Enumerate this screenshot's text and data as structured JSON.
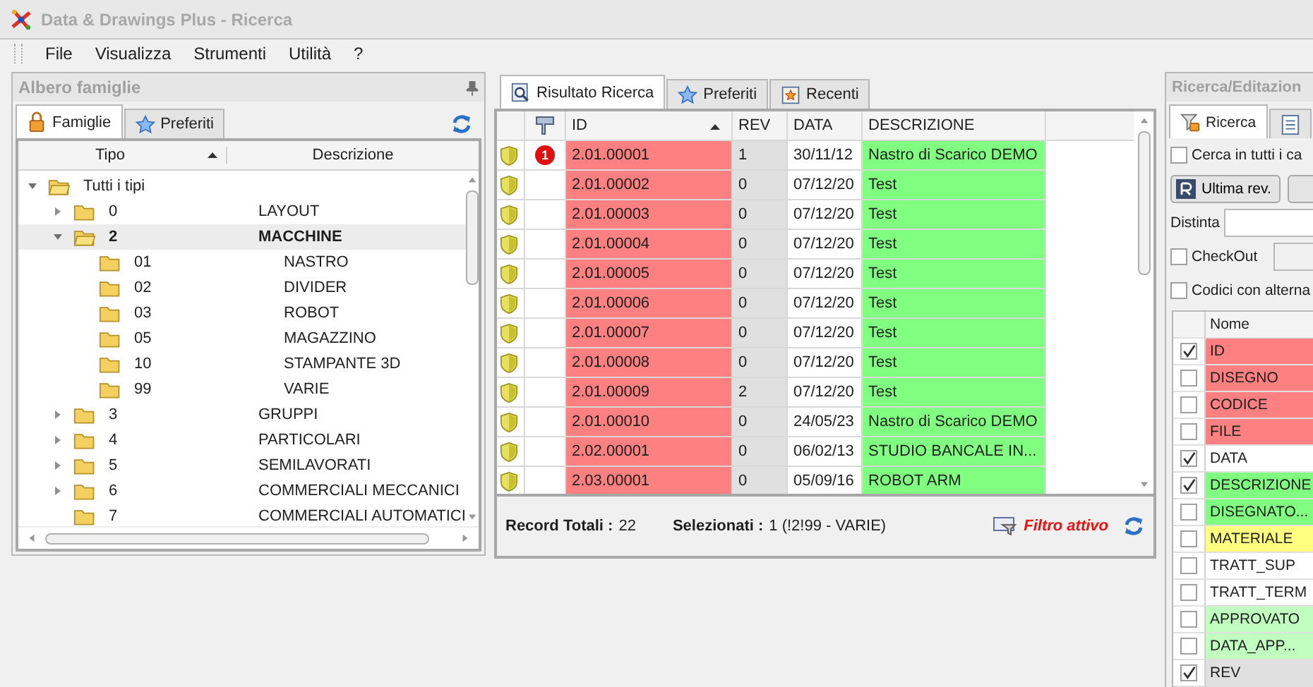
{
  "window": {
    "title": "Data & Drawings Plus - Ricerca"
  },
  "menu": [
    "File",
    "Visualizza",
    "Strumenti",
    "Utilità",
    "?"
  ],
  "left_panel": {
    "title": "Albero famiglie",
    "tabs": [
      {
        "label": "Famiglie",
        "selected": true
      },
      {
        "label": "Preferiti",
        "selected": false
      }
    ],
    "tree_columns": [
      "Tipo",
      "Descrizione"
    ],
    "tree": [
      {
        "code": "Tutti i tipi",
        "expanded": true,
        "selected": false,
        "children": [
          {
            "code": "0",
            "description": "LAYOUT",
            "expanded": false,
            "selected": false
          },
          {
            "code": "2",
            "description": "MACCHINE",
            "expanded": true,
            "selected": true,
            "children": [
              {
                "code": "01",
                "description": "NASTRO",
                "selected": false
              },
              {
                "code": "02",
                "description": "DIVIDER",
                "selected": false
              },
              {
                "code": "03",
                "description": "ROBOT",
                "selected": false
              },
              {
                "code": "05",
                "description": "MAGAZZINO",
                "selected": false
              },
              {
                "code": "10",
                "description": "STAMPANTE 3D",
                "selected": false
              },
              {
                "code": "99",
                "description": "VARIE",
                "selected": false
              }
            ]
          },
          {
            "code": "3",
            "description": "GRUPPI",
            "expanded": false,
            "selected": false
          },
          {
            "code": "4",
            "description": "PARTICOLARI",
            "expanded": false,
            "selected": false
          },
          {
            "code": "5",
            "description": "SEMILAVORATI",
            "expanded": false,
            "selected": false
          },
          {
            "code": "6",
            "description": "COMMERCIALI MECCANICI",
            "expanded": false,
            "selected": false
          },
          {
            "code": "7",
            "description": "COMMERCIALI AUTOMATICI",
            "selected": false
          }
        ]
      }
    ]
  },
  "center_panel": {
    "tabs": [
      {
        "label": "Risultato Ricerca",
        "selected": true
      },
      {
        "label": "Preferiti",
        "selected": false
      },
      {
        "label": "Recenti",
        "selected": false
      }
    ],
    "columns": [
      "ID",
      "REV",
      "DATA",
      "DESCRIZIONE"
    ],
    "rows": [
      {
        "badge": "1",
        "id": "2.01.00001",
        "rev": "1",
        "date": "30/11/12",
        "description": "Nastro di Scarico DEMO"
      },
      {
        "id": "2.01.00002",
        "rev": "0",
        "date": "07/12/20",
        "description": "Test"
      },
      {
        "id": "2.01.00003",
        "rev": "0",
        "date": "07/12/20",
        "description": "Test"
      },
      {
        "id": "2.01.00004",
        "rev": "0",
        "date": "07/12/20",
        "description": "Test"
      },
      {
        "id": "2.01.00005",
        "rev": "0",
        "date": "07/12/20",
        "description": "Test"
      },
      {
        "id": "2.01.00006",
        "rev": "0",
        "date": "07/12/20",
        "description": "Test"
      },
      {
        "id": "2.01.00007",
        "rev": "0",
        "date": "07/12/20",
        "description": "Test"
      },
      {
        "id": "2.01.00008",
        "rev": "0",
        "date": "07/12/20",
        "description": "Test"
      },
      {
        "id": "2.01.00009",
        "rev": "2",
        "date": "07/12/20",
        "description": "Test"
      },
      {
        "id": "2.01.00010",
        "rev": "0",
        "date": "24/05/23",
        "description": "Nastro di Scarico DEMO"
      },
      {
        "id": "2.02.00001",
        "rev": "0",
        "date": "06/02/13",
        "description": "STUDIO BANCALE IN..."
      },
      {
        "id": "2.03.00001",
        "rev": "0",
        "date": "05/09/16",
        "description": "ROBOT ARM"
      }
    ],
    "status": {
      "total_label": "Record Totali :",
      "total": "22",
      "selected_label": "Selezionati :",
      "selected": "1 (!2!99 - VARIE)",
      "filter": "Filtro attivo"
    }
  },
  "right_panel": {
    "title": "Ricerca/Editazion",
    "tabs": [
      {
        "label": "Ricerca",
        "selected": true
      },
      {
        "selected": false
      }
    ],
    "search_all": {
      "label": "Cerca in tutti i ca",
      "checked": false
    },
    "button": "Ultima rev.",
    "distinta_label": "Distinta",
    "checkout": {
      "label": "CheckOut",
      "checked": false
    },
    "alternatives": {
      "label": "Codici con alterna",
      "checked": false
    },
    "list_header": "Nome",
    "fields": [
      {
        "name": "ID",
        "checked": true,
        "color": "#ff8080"
      },
      {
        "name": "DISEGNO",
        "checked": false,
        "color": "#ff8080"
      },
      {
        "name": "CODICE",
        "checked": false,
        "color": "#ff8080"
      },
      {
        "name": "FILE",
        "checked": false,
        "color": "#ff8080"
      },
      {
        "name": "DATA",
        "checked": true,
        "color": "#ffffff"
      },
      {
        "name": "DESCRIZIONE",
        "checked": true,
        "color": "#80ff80"
      },
      {
        "name": "DISEGNATO...",
        "checked": false,
        "color": "#80ff80"
      },
      {
        "name": "MATERIALE",
        "checked": false,
        "color": "#ffff80"
      },
      {
        "name": "TRATT_SUP",
        "checked": false,
        "color": "#ffffff"
      },
      {
        "name": "TRATT_TERM",
        "checked": false,
        "color": "#ffffff"
      },
      {
        "name": "APPROVATO",
        "checked": false,
        "color": "#c0ffc0"
      },
      {
        "name": "DATA_APP...",
        "checked": false,
        "color": "#c0ffc0"
      },
      {
        "name": "REV",
        "checked": true,
        "color": "#e0e0e0"
      }
    ]
  }
}
